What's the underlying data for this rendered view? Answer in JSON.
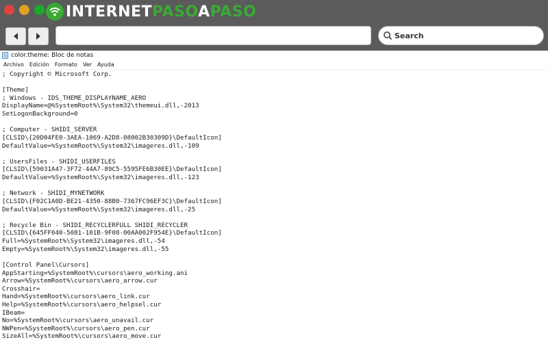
{
  "browser": {
    "brand_word1": "INTERNET",
    "brand_word2": "PASO",
    "brand_word3": "A",
    "brand_word4": "PASO",
    "search_label": "Search",
    "colors": {
      "chrome": "#5b5b5b",
      "brand_green": "#3aaa35",
      "close": "#e0443e",
      "minimize": "#dea123",
      "maximize": "#1aab29"
    }
  },
  "window": {
    "title": "color.theme: Bloc de notas",
    "menu": [
      "Archivo",
      "Edición",
      "Formato",
      "Ver",
      "Ayuda"
    ]
  },
  "editor": {
    "lines": [
      "; Copyright © Microsoft Corp.",
      "",
      "[Theme]",
      "; Windows - IDS_THEME_DISPLAYNAME_AERO",
      "DisplayName=@%SystemRoot%\\System32\\themeui.dll,-2013",
      "SetLogonBackground=0",
      "",
      "; Computer - SHIDI_SERVER",
      "[CLSID\\{20D04FE0-3AEA-1069-A2D8-08002B30309D}\\DefaultIcon]",
      "DefaultValue=%SystemRoot%\\System32\\imageres.dll,-109",
      "",
      "; UsersFiles - SHIDI_USERFILES",
      "[CLSID\\{59031A47-3F72-44A7-89C5-5595FE6B30EE}\\DefaultIcon]",
      "DefaultValue=%SystemRoot%\\System32\\imageres.dll,-123",
      "",
      "; Network - SHIDI_MYNETWORK",
      "[CLSID\\{F02C1A0D-BE21-4350-88B0-7367FC96EF3C}\\DefaultIcon]",
      "DefaultValue=%SystemRoot%\\System32\\imageres.dll,-25",
      "",
      "; Recycle Bin - SHIDI_RECYCLERFULL SHIDI_RECYCLER",
      "[CLSID\\{645FF040-5081-101B-9F08-00AA002F954E}\\DefaultIcon]",
      "Full=%SystemRoot%\\System32\\imageres.dll,-54",
      "Empty=%SystemRoot%\\System32\\imageres.dll,-55",
      "",
      "[Control Panel\\Cursors]",
      "AppStarting=%SystemRoot%\\cursors\\aero_working.ani",
      "Arrow=%SystemRoot%\\cursors\\aero_arrow.cur",
      "Crosshair=",
      "Hand=%SystemRoot%\\cursors\\aero_link.cur",
      "Help=%SystemRoot%\\cursors\\aero_helpsel.cur",
      "IBeam=",
      "No=%SystemRoot%\\cursors\\aero_unavail.cur",
      "NWPen=%SystemRoot%\\cursors\\aero_pen.cur",
      "SizeAll=%SystemRoot%\\cursors\\aero_move.cur"
    ]
  }
}
